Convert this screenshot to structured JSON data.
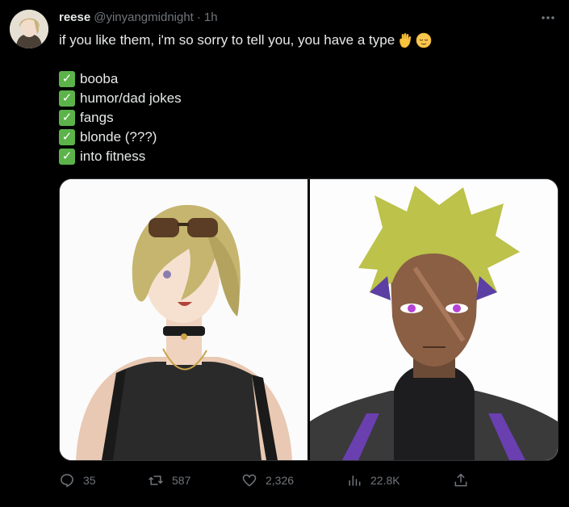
{
  "tweet": {
    "author_name": "reese",
    "author_handle": "@yinyangmidnight",
    "separator": "·",
    "time": "1h",
    "line1": "if you like them, i'm so sorry to tell you, you have a type",
    "list": [
      "booba",
      "humor/dad jokes",
      "fangs",
      "blonde (???)",
      "into fitness"
    ]
  },
  "stats": {
    "replies": "35",
    "retweets": "587",
    "likes": "2,326",
    "views": "22.8K"
  },
  "icons": {
    "more": "more-icon",
    "reply": "reply-icon",
    "retweet": "retweet-icon",
    "like": "heart-icon",
    "views": "views-icon",
    "share": "share-icon"
  },
  "colors": {
    "background": "#000000",
    "text": "#e7e9ea",
    "muted": "#71767b",
    "check": "#5bb34a"
  }
}
